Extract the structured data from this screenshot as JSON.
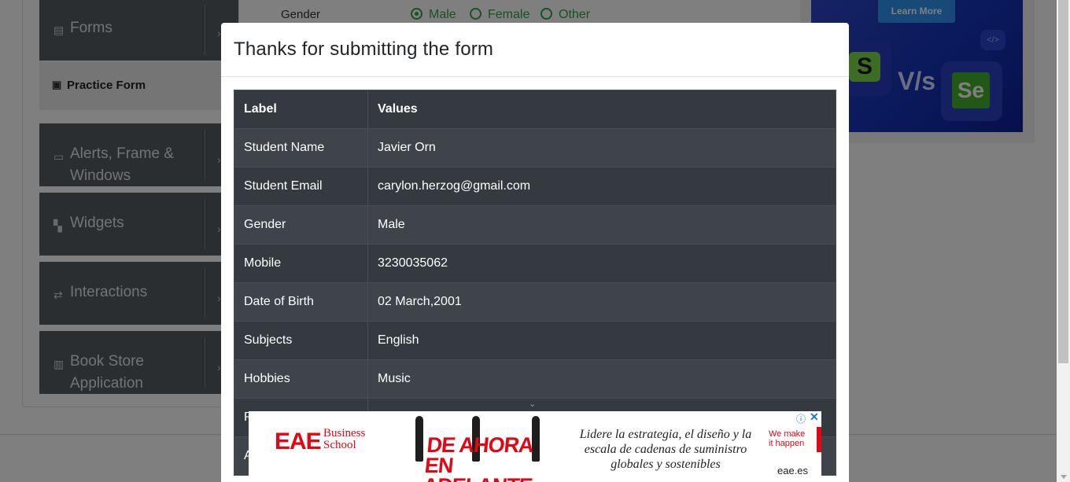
{
  "sidebar": {
    "groups": [
      {
        "label": "Forms",
        "icon": "document-icon",
        "top": 0
      },
      {
        "label": "Alerts, Frame &\nWindows",
        "icon": "window-icon"
      },
      {
        "label": "Widgets",
        "icon": "widgets-icon"
      },
      {
        "label": "Interactions",
        "icon": "interactions-icon"
      },
      {
        "label": "Book Store\nApplication",
        "icon": "books-icon"
      }
    ],
    "active_item": {
      "label": "Practice Form",
      "icon": "form-icon"
    }
  },
  "form_behind": {
    "gender_label": "Gender",
    "options": [
      "Male",
      "Female",
      "Other"
    ],
    "selected": "Male"
  },
  "side_ad": {
    "button_label": "Learn More",
    "vs_text": "V/s",
    "left_logo": "S",
    "right_logo": "Se"
  },
  "modal": {
    "title": "Thanks for submitting the form",
    "headers": {
      "label": "Label",
      "values": "Values"
    },
    "rows": [
      {
        "label": "Student Name",
        "value": "Javier Orn"
      },
      {
        "label": "Student Email",
        "value": "carylon.herzog@gmail.com"
      },
      {
        "label": "Gender",
        "value": "Male"
      },
      {
        "label": "Mobile",
        "value": "3230035062"
      },
      {
        "label": "Date of Birth",
        "value": "02 March,2001"
      },
      {
        "label": "Subjects",
        "value": "English"
      },
      {
        "label": "Hobbies",
        "value": "Music"
      },
      {
        "label": "P",
        "value": ""
      },
      {
        "label": "A",
        "value": ""
      }
    ]
  },
  "bottom_ad": {
    "brand": "EAE",
    "brand_sub": "Business\nSchool",
    "promo_text": "DE AHORA\nEN ADELANTE",
    "tagline": "Lidere la estrategia, el diseño y la escala de cadenas de suministro globales y sostenibles",
    "slogan": "We make\nit happen",
    "domain": "eae.es",
    "adchoice": "ⓘ",
    "close": "✕"
  },
  "colors": {
    "table_dark": "#343a40",
    "table_stripe": "#3e444a",
    "radio_green": "#28a745",
    "ad_red": "#e30613"
  }
}
